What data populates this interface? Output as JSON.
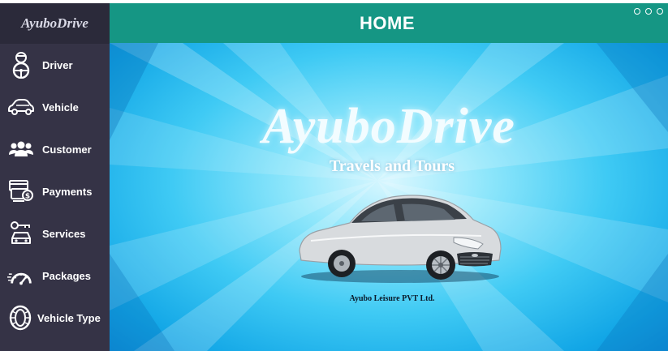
{
  "app": {
    "brand": "AyuboDrive",
    "header_title": "HOME"
  },
  "sidebar": {
    "items": [
      {
        "label": "Driver",
        "icon": "driver-icon"
      },
      {
        "label": "Vehicle",
        "icon": "car-icon"
      },
      {
        "label": "Customer",
        "icon": "customers-icon"
      },
      {
        "label": "Payments",
        "icon": "payments-icon"
      },
      {
        "label": "Services",
        "icon": "services-icon"
      },
      {
        "label": "Packages",
        "icon": "speedometer-icon"
      },
      {
        "label": "Vehicle Type",
        "icon": "tire-icon"
      }
    ]
  },
  "hero": {
    "title": "AyuboDrive",
    "subtitle": "Travels and Tours",
    "company": "Ayubo Leisure PVT Ltd."
  },
  "colors": {
    "sidebar": "#353346",
    "header": "#159684",
    "background": "#3fcaf4"
  }
}
